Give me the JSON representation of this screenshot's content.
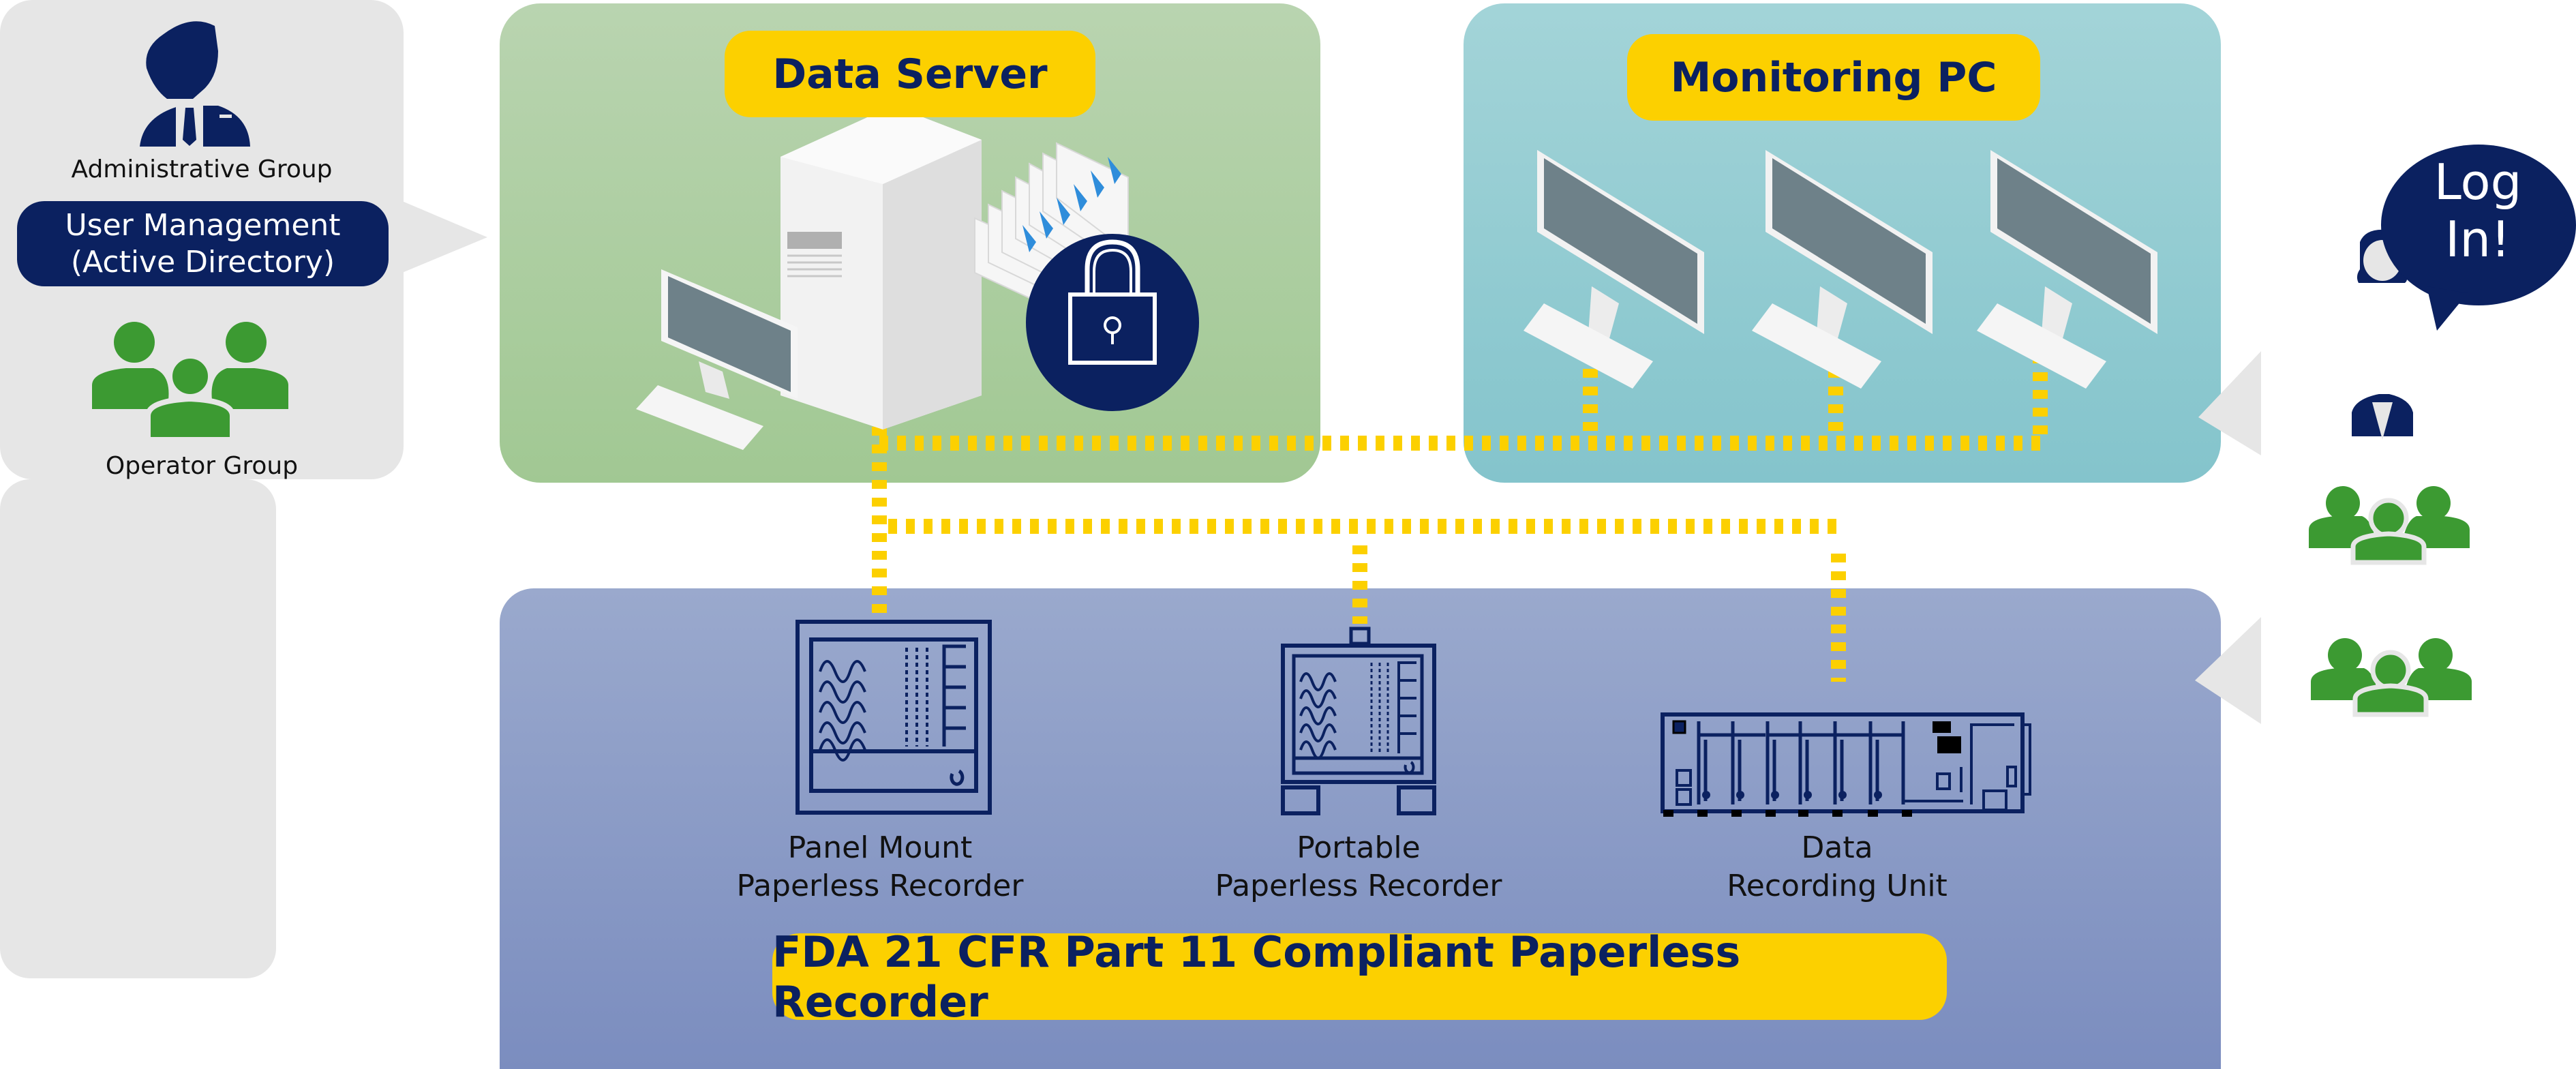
{
  "left_group": {
    "admin_label": "Administrative Group",
    "user_management": {
      "line1": "User Management",
      "line2": "(Active Directory)"
    },
    "operator_label": "Operator Group"
  },
  "data_server": {
    "title": "Data Server"
  },
  "monitoring_pc": {
    "title": "Monitoring PC",
    "monitor_count": 3
  },
  "recorder_panel": {
    "title": "FDA 21 CFR Part 11 Compliant Paperless Recorder",
    "devices": [
      {
        "line1": "Panel Mount",
        "line2": "Paperless Recorder"
      },
      {
        "line1": "Portable",
        "line2": "Paperless Recorder"
      },
      {
        "line1": "Data",
        "line2": "Recording Unit"
      }
    ]
  },
  "right_group": {
    "speech": {
      "line1": "Log",
      "line2": "In!"
    }
  },
  "icons": [
    "admin-user-icon",
    "operator-group-icon",
    "server-tower-icon",
    "document-stack-icon",
    "padlock-icon",
    "monitor-icon",
    "keyboard-icon",
    "panel-recorder-icon",
    "portable-recorder-icon",
    "data-recording-unit-icon",
    "female-user-icon",
    "speech-bubble-icon"
  ],
  "colors": {
    "navy": "#0b2160",
    "yellow": "#fcd000",
    "green": "#3c9a32",
    "gray_panel": "#e6e6e6",
    "server_panel": "#b0cfa5",
    "pc_panel": "#93cbd1",
    "recorder_panel": "#8c9bc7"
  }
}
